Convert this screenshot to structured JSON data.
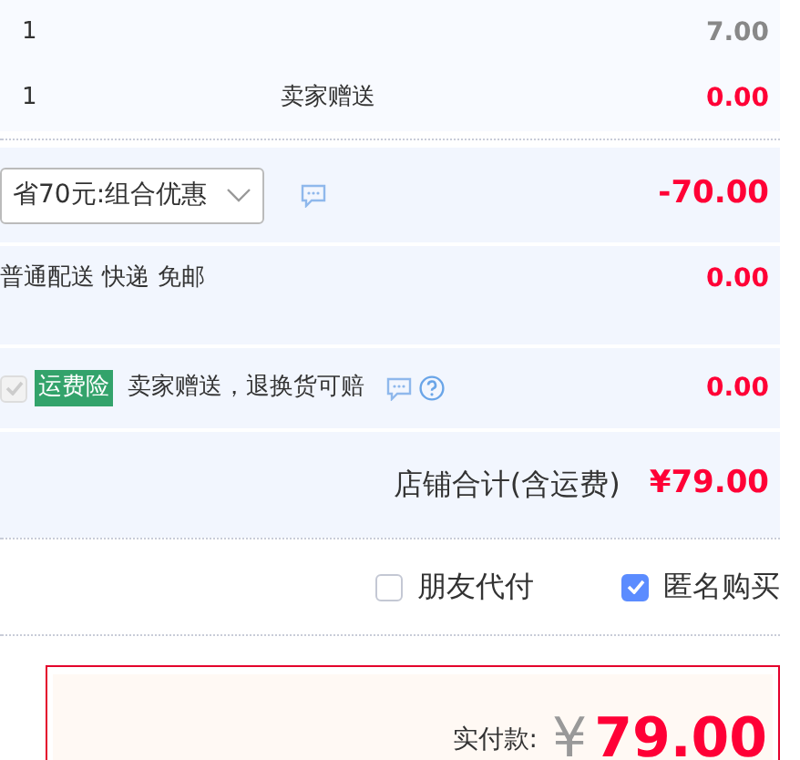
{
  "items": [
    {
      "quantity": "1",
      "price": "7.00",
      "kind": "regular"
    },
    {
      "quantity": "1",
      "note": "卖家赠送",
      "price": "0.00",
      "kind": "gift"
    }
  ],
  "promotion": {
    "select_value": "省70元:组合优惠",
    "amount": "-70.00"
  },
  "shipping": {
    "label": "普通配送 快递 免邮",
    "amount": "0.00"
  },
  "insurance": {
    "checked": true,
    "disabled": true,
    "tag": "运费险",
    "text": "卖家赠送，退换货可赔",
    "amount": "0.00"
  },
  "store_total": {
    "label": "店铺合计(含运费)",
    "amount": "¥79.00"
  },
  "options": [
    {
      "label": "朋友代付",
      "checked": false
    },
    {
      "label": "匿名购买",
      "checked": true
    }
  ],
  "payment": {
    "label": "实付款:",
    "currency": "¥",
    "amount": "79.00"
  }
}
